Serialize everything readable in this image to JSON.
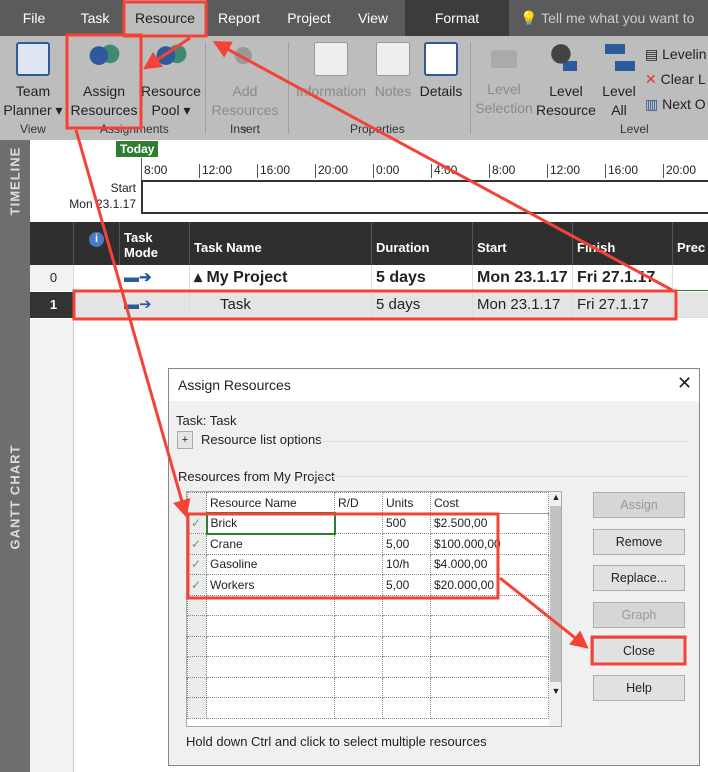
{
  "tabs": [
    "File",
    "Task",
    "Resource",
    "Report",
    "Project",
    "View",
    "Format"
  ],
  "tell_me": "Tell me what you want to",
  "ribbon": {
    "team_planner": [
      "Team",
      "Planner ▾"
    ],
    "assign_resources": [
      "Assign",
      "Resources"
    ],
    "resource_pool": [
      "Resource",
      "Pool ▾"
    ],
    "add_resources": [
      "Add",
      "Resources ▾"
    ],
    "information": "Information",
    "notes": "Notes",
    "details": "Details",
    "level_selection": [
      "Level",
      "Selection"
    ],
    "level_resource": [
      "Level",
      "Resource"
    ],
    "level_all": [
      "Level",
      "All"
    ],
    "leveling": "Levelin",
    "clear": "Clear L",
    "next": "Next O",
    "groups": [
      "View",
      "Assignments",
      "Insert",
      "Properties",
      "Level"
    ]
  },
  "timeline": {
    "label": "TIMELINE",
    "today": "Today",
    "ticks": [
      "8:00",
      "12:00",
      "16:00",
      "20:00",
      "0:00",
      "4:00",
      "8:00",
      "12:00",
      "16:00",
      "20:00"
    ],
    "start_label": "Start",
    "start_date": "Mon 23.1.17"
  },
  "gantt": {
    "label": "GANTT CHART",
    "headers": [
      "Task Mode",
      "Task Name",
      "Duration",
      "Start",
      "Finish",
      "Prec"
    ],
    "rows": [
      {
        "id": "0",
        "name": "▴ My Project",
        "duration": "5 days",
        "start": "Mon 23.1.17",
        "finish": "Fri 27.1.17"
      },
      {
        "id": "1",
        "name": "Task",
        "duration": "5 days",
        "start": "Mon 23.1.17",
        "finish": "Fri 27.1.17"
      }
    ]
  },
  "dialog": {
    "title": "Assign Resources",
    "task": "Task: Task",
    "options": "Resource list options",
    "section": "Resources from My Project",
    "columns": [
      "Resource Name",
      "R/D",
      "Units",
      "Cost"
    ],
    "resources": [
      {
        "name": "Brick",
        "rd": "",
        "units": "500",
        "cost": "$2.500,00"
      },
      {
        "name": "Crane",
        "rd": "",
        "units": "5,00",
        "cost": "$100.000,00"
      },
      {
        "name": "Gasoline",
        "rd": "",
        "units": "10/h",
        "cost": "$4.000,00"
      },
      {
        "name": "Workers",
        "rd": "",
        "units": "5,00",
        "cost": "$20.000,00"
      }
    ],
    "buttons": [
      "Assign",
      "Remove",
      "Replace...",
      "Graph",
      "Close",
      "Help"
    ],
    "hint": "Hold down Ctrl and click to select multiple resources"
  },
  "colors": {
    "annotation": "#f44336",
    "today": "#2e7d32",
    "header": "#2f2f2f"
  }
}
